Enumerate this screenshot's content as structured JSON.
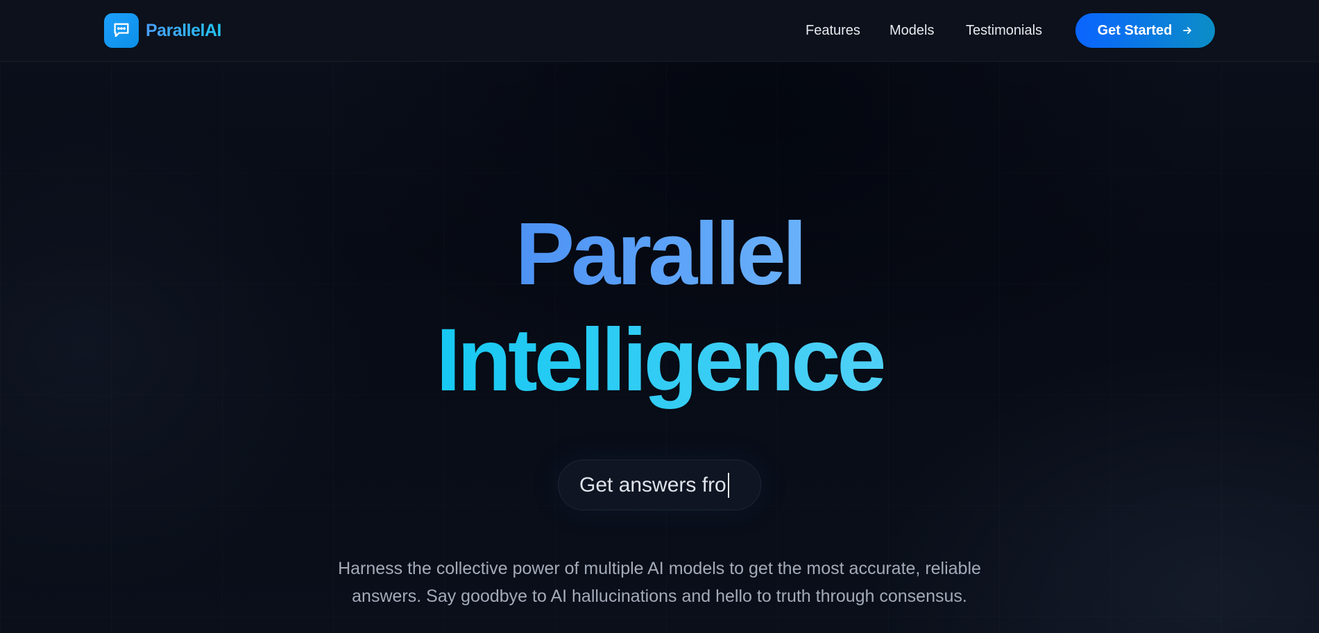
{
  "header": {
    "brand": "ParallelAI",
    "logo_icon": "chat-bubble-icon",
    "nav": [
      "Features",
      "Models",
      "Testimonials"
    ],
    "cta_label": "Get Started",
    "cta_icon": "arrow-right-icon"
  },
  "hero": {
    "title_line1": "Parallel",
    "title_line2": "Intelligence",
    "typing_text": "Get answers fro",
    "description": "Harness the collective power of multiple AI models to get the most accurate, reliable answers. Say goodbye to AI hallucinations and hello to truth through consensus."
  },
  "colors": {
    "background": "#070b14",
    "accent_blue": "#0a64ff",
    "accent_cyan": "#16c9f2",
    "brand_gradient_start": "#4a9ef9",
    "brand_gradient_end": "#22c3f0"
  }
}
